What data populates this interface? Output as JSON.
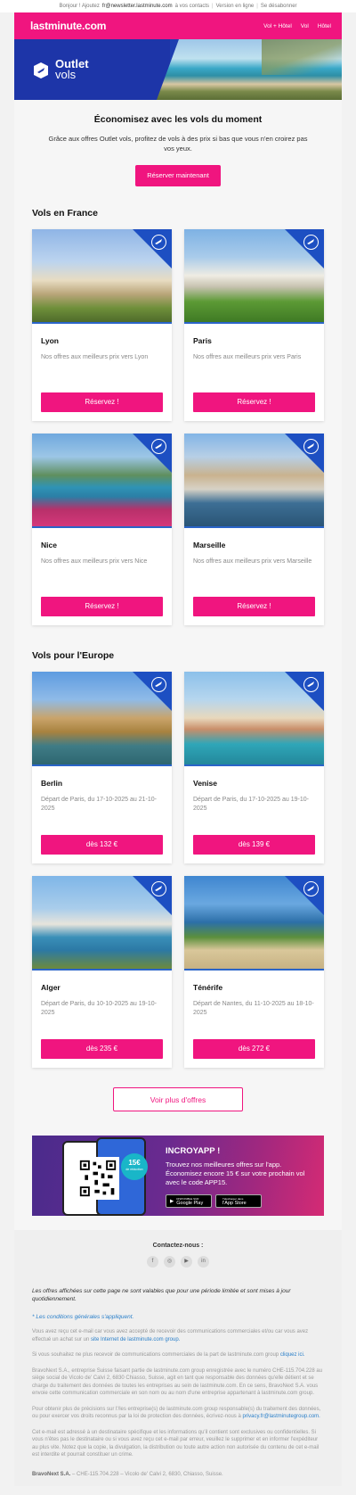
{
  "top_bar": {
    "greeting": "Bonjour ! Ajoutez",
    "email": "fr@newsletter.lastminute.com",
    "to_contacts": "à vos contacts",
    "online": "Version en ligne",
    "unsubscribe": "Se désabonner"
  },
  "header": {
    "logo": "lastminute.com",
    "nav": [
      "Vol + Hôtel",
      "Vol",
      "Hôtel"
    ]
  },
  "hero": {
    "title_line1": "Outlet",
    "title_line2": "vols"
  },
  "intro": {
    "title": "Économisez avec les vols du moment",
    "text": "Grâce aux offres Outlet vols, profitez de vols à des prix si bas que vous n'en croirez pas vos yeux.",
    "cta": "Réserver maintenant"
  },
  "france": {
    "title": "Vols en France",
    "cards": [
      {
        "city": "Lyon",
        "desc": "Nos offres aux meilleurs prix vers Lyon",
        "btn": "Réservez !"
      },
      {
        "city": "Paris",
        "desc": "Nos offres aux meilleurs prix vers Paris",
        "btn": "Réservez !"
      },
      {
        "city": "Nice",
        "desc": "Nos offres aux meilleurs prix vers Nice",
        "btn": "Réservez !"
      },
      {
        "city": "Marseille",
        "desc": "Nos offres aux meilleurs prix vers Marseille",
        "btn": "Réservez !"
      }
    ]
  },
  "europe": {
    "title": "Vols pour l'Europe",
    "cards": [
      {
        "city": "Berlin",
        "desc": "Départ de Paris, du 17-10-2025 au 21-10-2025",
        "btn": "dès 132 €"
      },
      {
        "city": "Venise",
        "desc": "Départ de Paris, du 17-10-2025 au 19-10-2025",
        "btn": "dès 139 €"
      },
      {
        "city": "Alger",
        "desc": "Départ de Paris, du 10-10-2025 au 19-10-2025",
        "btn": "dès 235 €"
      },
      {
        "city": "Ténérife",
        "desc": "Départ de Nantes, du 11-10-2025 au 18-10-2025",
        "btn": "dès 272 €"
      }
    ]
  },
  "more_offers": "Voir plus d'offres",
  "app": {
    "title": "INCROYAPP !",
    "text": "Trouvez nos meilleures offres sur l'app. Économisez encore 15 € sur votre prochain vol avec le code APP15.",
    "coupon": "15€",
    "coupon_sub": "de réduction",
    "google_sub": "DISPONIBLE SUR",
    "google": "Google Play",
    "apple_sub": "Télécharger dans",
    "apple": "l'App Store"
  },
  "footer": {
    "contact": "Contactez-nous :",
    "socials": [
      "f",
      "◎",
      "▶",
      "in"
    ],
    "limited": "Les offres affichées sur cette page ne sont valables que pour une période limitée et sont mises à jour quotidiennement.",
    "conditions": "* Les conditions générales s'appliquent.",
    "p1": "Vous avez reçu cet e-mail car vous avez accepté de recevoir des communications commerciales et/ou car vous avez effectué un achat sur un",
    "p1_link": "site Internet de lastminute.com group.",
    "p2": "Si vous souhaitez ne plus recevoir de communications commerciales de la part de lastminute.com group",
    "p2_link": "cliquez ici.",
    "p3": "BravoNext S.A., entreprise Suisse faisant partie de lastminute.com group enregistrée avec le numéro CHE-115.704.228 au siège social de Vicolo de' Calvi 2, 6830 Chiasso, Suisse, agit en tant que responsable des données qu'elle détient et se charge du traitement des données de toutes les entreprises au sein de lastminute.com. En ce sens, BravoNext S.A. vous envoie cette communication commerciale en son nom ou au nom d'une entreprise appartenant à lastminute.com group.",
    "p4": "Pour obtenir plus de précisions sur l'/les entreprise(s) de lastminute.com group responsable(s) du traitement des données, ou pour exercer vos droits reconnus par la loi de protection des données, écrivez-nous à",
    "p4_link": "privacy.fr@lastminutegroup.com.",
    "p5": "Cet e-mail est adressé à un destinataire spécifique et les informations qu'il contient sont exclusives ou confidentielles. Si vous n'êtes pas le destinataire ou si vous avez reçu cet e-mail par erreur, veuillez le supprimer et en informer l'expéditeur au plus vite. Notez que la copie, la divulgation, la distribution ou toute autre action non autorisée du contenu de cet e-mail est interdite et pourrait constituer un crime.",
    "addr_bold": "BravoNext S.A.",
    "addr": " – CHE-115.704.228 – Vicolo de' Calvi 2, 6830, Chiasso, Suisse."
  },
  "colors": {
    "brand": "#f0157f",
    "blue": "#1d35a8"
  }
}
